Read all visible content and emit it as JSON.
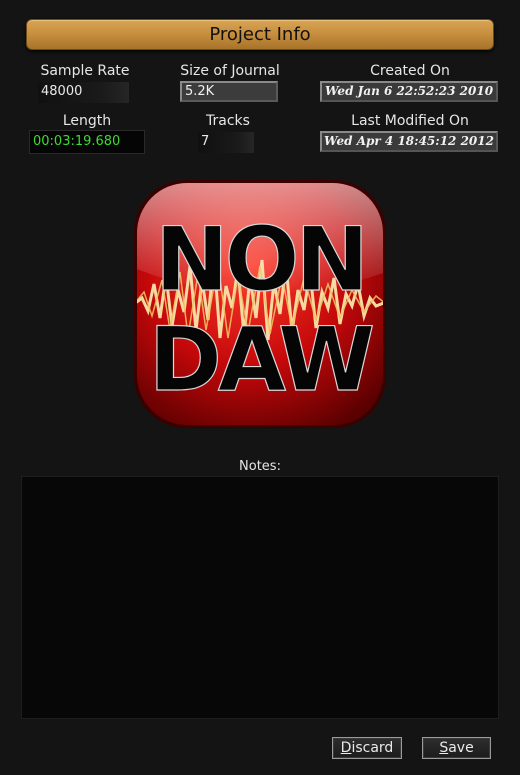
{
  "title": "Project Info",
  "fields": {
    "sample_rate": {
      "label": "Sample Rate",
      "value": "48000"
    },
    "journal_size": {
      "label": "Size of Journal",
      "value": "5.2K"
    },
    "created_on": {
      "label": "Created On",
      "value": "Wed Jan  6 22:52:23 2010"
    },
    "length": {
      "label": "Length",
      "value": "00:03:19.680"
    },
    "tracks": {
      "label": "Tracks",
      "value": "7"
    },
    "last_modified": {
      "label": "Last Modified On",
      "value": "Wed Apr  4 18:45:12 2012"
    }
  },
  "logo": {
    "text_top": "NON",
    "text_bottom": "DAW"
  },
  "notes": {
    "label": "Notes:",
    "value": ""
  },
  "buttons": {
    "discard": {
      "mnemonic": "D",
      "rest": "iscard"
    },
    "save": {
      "mnemonic": "S",
      "rest": "ave"
    }
  },
  "colors": {
    "title_bar": "#c8903f",
    "length_text": "#3bdc2f",
    "logo_red": "#c4080a"
  }
}
